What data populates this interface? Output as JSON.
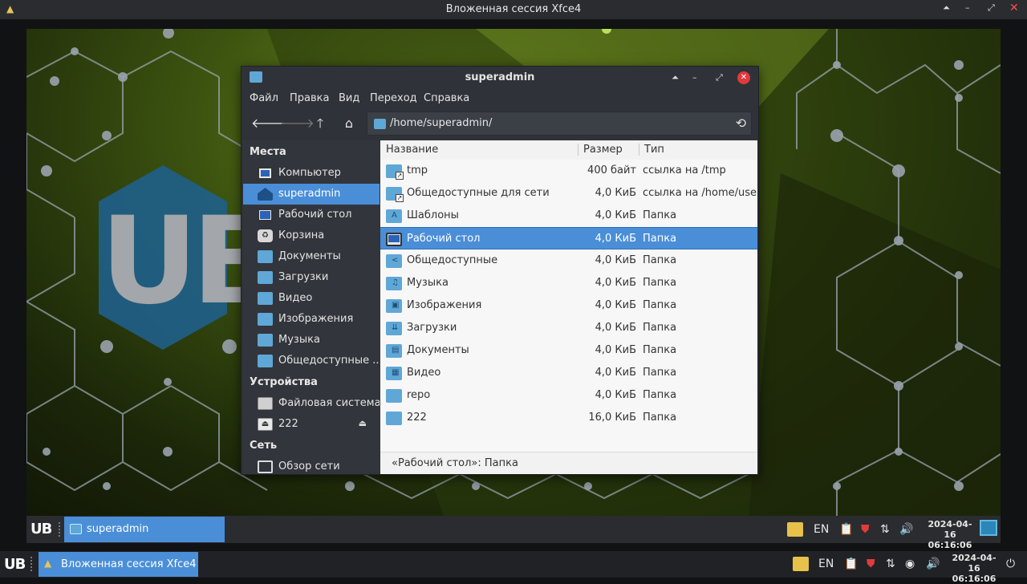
{
  "outer_window": {
    "title": "Вложенная сессия Xfce4"
  },
  "file_manager": {
    "title": "superadmin",
    "menu": [
      "Файл",
      "Правка",
      "Вид",
      "Переход",
      "Справка"
    ],
    "path": "/home/superadmin/",
    "sidebar": {
      "places_header": "Места",
      "places": [
        {
          "label": "Компьютер",
          "icon": "computer-icon"
        },
        {
          "label": "superadmin",
          "icon": "home-icon",
          "selected": true
        },
        {
          "label": "Рабочий стол",
          "icon": "desktop-icon"
        },
        {
          "label": "Корзина",
          "icon": "trash-icon"
        },
        {
          "label": "Документы",
          "icon": "documents-folder-icon"
        },
        {
          "label": "Загрузки",
          "icon": "downloads-folder-icon"
        },
        {
          "label": "Видео",
          "icon": "videos-folder-icon"
        },
        {
          "label": "Изображения",
          "icon": "pictures-folder-icon"
        },
        {
          "label": "Музыка",
          "icon": "music-folder-icon"
        },
        {
          "label": "Общедоступные ...",
          "icon": "public-folder-link-icon"
        }
      ],
      "devices_header": "Устройства",
      "devices": [
        {
          "label": "Файловая система",
          "icon": "drive-icon"
        },
        {
          "label": "222",
          "icon": "removable-drive-icon"
        }
      ],
      "network_header": "Сеть",
      "network": [
        {
          "label": "Обзор сети",
          "icon": "network-icon"
        }
      ]
    },
    "columns": {
      "name": "Название",
      "size": "Размер",
      "type": "Тип"
    },
    "rows": [
      {
        "name": "tmp",
        "size": "400 байт",
        "type": "ссылка на /tmp",
        "icon": "folder-link-icon"
      },
      {
        "name": "Общедоступные для сети",
        "size": "4,0 КиБ",
        "type": "ссылка на /home/usersh",
        "icon": "folder-link-icon"
      },
      {
        "name": "Шаблоны",
        "size": "4,0 КиБ",
        "type": "Папка",
        "icon": "templates-folder-icon"
      },
      {
        "name": "Рабочий стол",
        "size": "4,0 КиБ",
        "type": "Папка",
        "icon": "desktop-folder-icon",
        "selected": true
      },
      {
        "name": "Общедоступные",
        "size": "4,0 КиБ",
        "type": "Папка",
        "icon": "public-folder-icon"
      },
      {
        "name": "Музыка",
        "size": "4,0 КиБ",
        "type": "Папка",
        "icon": "music-folder-icon"
      },
      {
        "name": "Изображения",
        "size": "4,0 КиБ",
        "type": "Папка",
        "icon": "pictures-folder-icon"
      },
      {
        "name": "Загрузки",
        "size": "4,0 КиБ",
        "type": "Папка",
        "icon": "downloads-folder-icon"
      },
      {
        "name": "Документы",
        "size": "4,0 КиБ",
        "type": "Папка",
        "icon": "documents-folder-icon"
      },
      {
        "name": "Видео",
        "size": "4,0 КиБ",
        "type": "Папка",
        "icon": "videos-folder-icon"
      },
      {
        "name": "repo",
        "size": "4,0 КиБ",
        "type": "Папка",
        "icon": "folder-icon"
      },
      {
        "name": "222",
        "size": "16,0 КиБ",
        "type": "Папка",
        "icon": "folder-icon"
      }
    ],
    "status": "«Рабочий стол»: Папка"
  },
  "desktop": {
    "wallpaper_logo": "UB"
  },
  "inner_panel": {
    "logo": "UB",
    "task": "superadmin",
    "lang": "EN",
    "date": "2024-04-16",
    "time": "06:16:06"
  },
  "outer_panel": {
    "logo": "UB",
    "task": "Вложенная сессия Xfce4",
    "lang": "EN",
    "date": "2024-04-16",
    "time": "06:16:06"
  },
  "colors": {
    "accent": "#4a8ed8",
    "folder": "#5fa7d6",
    "close": "#e0393e"
  }
}
